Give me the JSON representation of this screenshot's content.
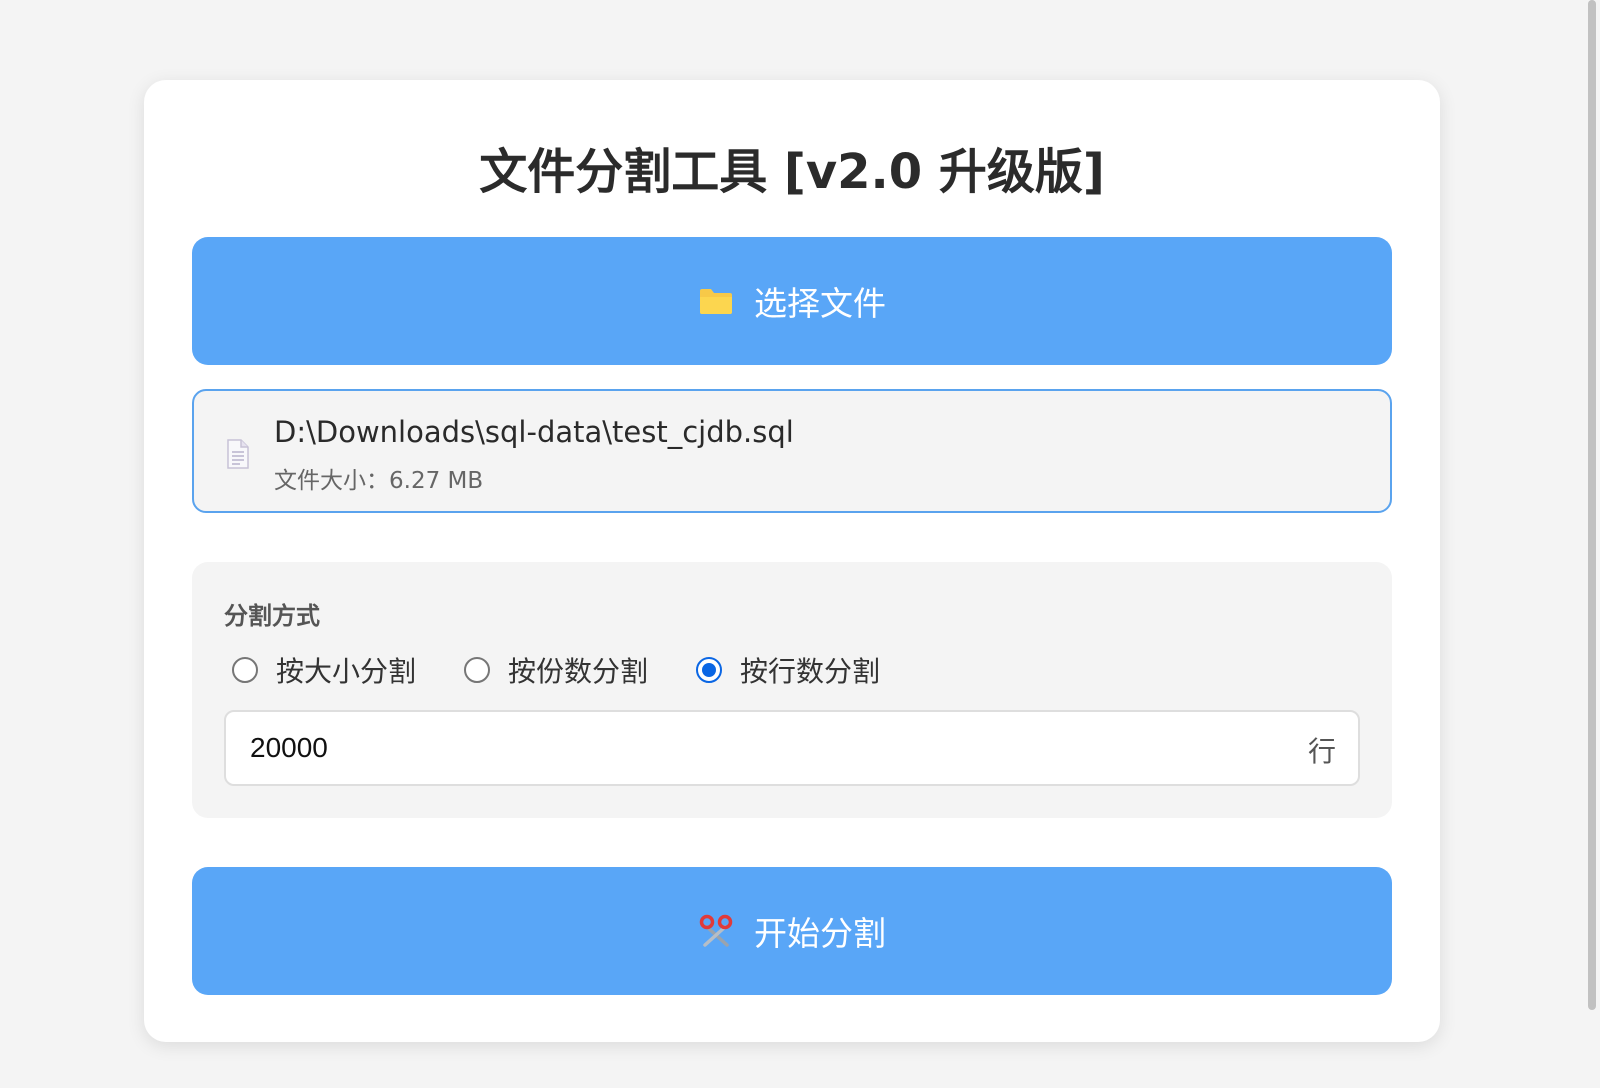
{
  "title": "文件分割工具 [v2.0 升级版]",
  "select_button": {
    "label": "选择文件",
    "icon": "folder-icon"
  },
  "file_info": {
    "path": "D:\\Downloads\\sql-data\\test_cjdb.sql",
    "size": "文件大小：6.27 MB",
    "icon": "document-icon"
  },
  "split": {
    "heading": "分割方式",
    "options": [
      {
        "label": "按大小分割",
        "checked": false
      },
      {
        "label": "按份数分割",
        "checked": false
      },
      {
        "label": "按行数分割",
        "checked": true
      }
    ],
    "value": "20000",
    "unit": "行"
  },
  "start_button": {
    "label": "开始分割",
    "icon": "scissors-icon"
  },
  "colors": {
    "primary": "#59a6f7",
    "file_border": "#5aa3ee",
    "radio_checked": "#0a66e4",
    "folder": "#f7c948",
    "scissors": "#e03a3a"
  }
}
